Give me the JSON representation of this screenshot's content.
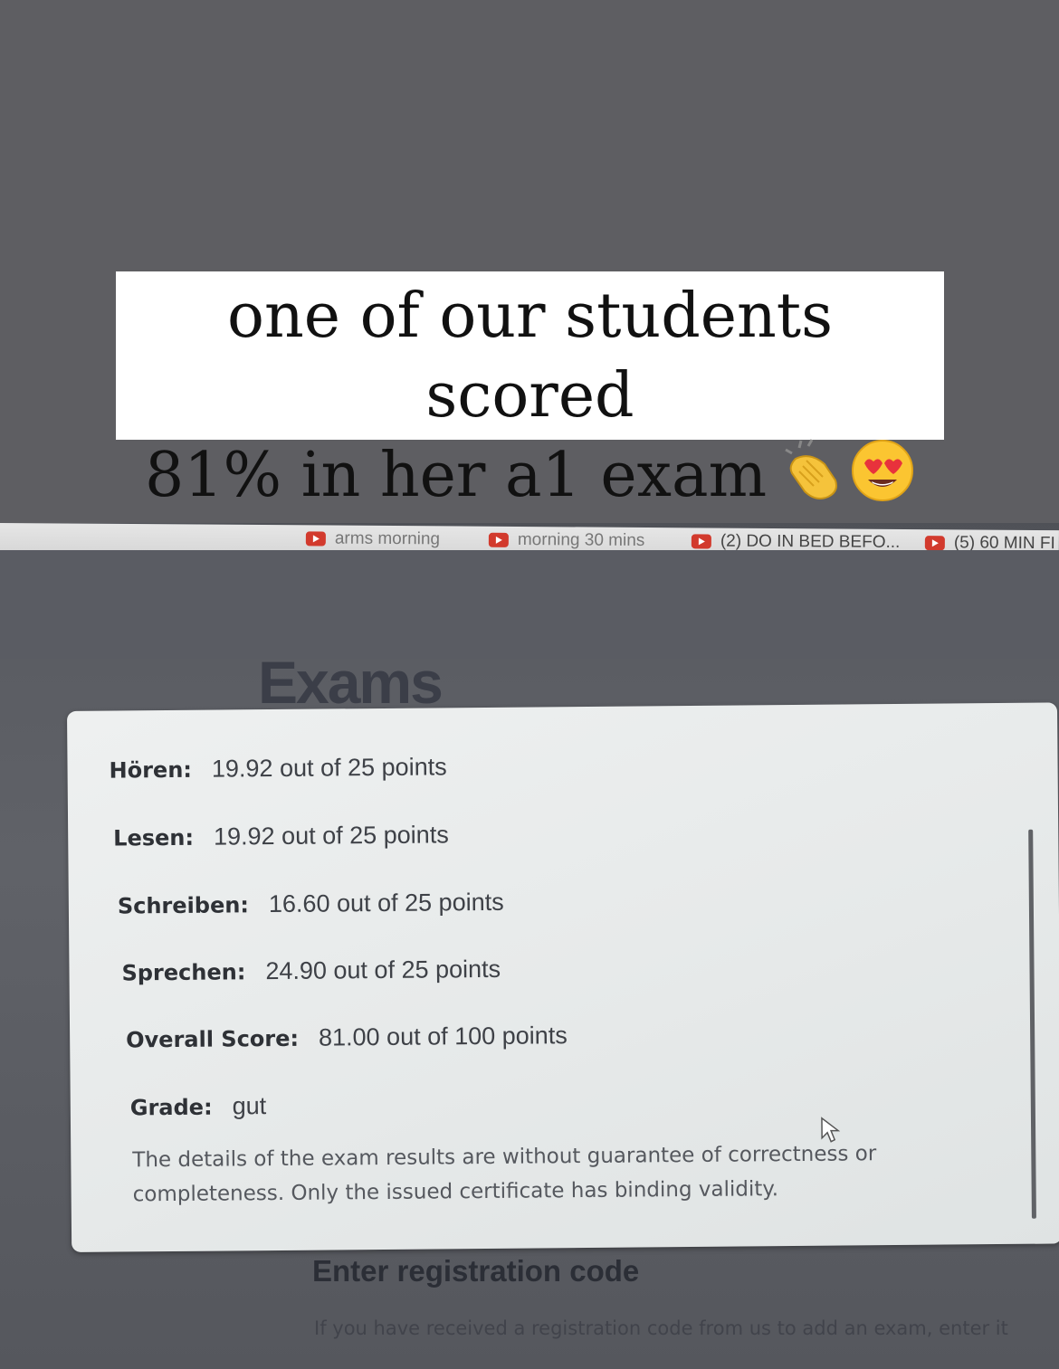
{
  "story": {
    "caption_line1": "one of our students scored",
    "caption_line2": "81% in her a1 exam",
    "emojis": [
      "clapping-hands-icon",
      "heart-eyes-face-icon"
    ]
  },
  "browser": {
    "bookmarks": [
      {
        "label": "arms morning",
        "icon": "youtube-icon"
      },
      {
        "label": "morning 30 mins",
        "icon": "youtube-icon"
      },
      {
        "label": "(2) DO IN BED BEFO...",
        "icon": "youtube-icon"
      },
      {
        "label": "(5) 60 MIN FI",
        "icon": "youtube-icon"
      }
    ]
  },
  "page": {
    "title": "Exams",
    "results": [
      {
        "label": "Hören:",
        "value": "19.92 out of 25 points"
      },
      {
        "label": "Lesen:",
        "value": "19.92 out of 25 points"
      },
      {
        "label": "Schreiben:",
        "value": "16.60 out of 25 points"
      },
      {
        "label": "Sprechen:",
        "value": "24.90 out of 25 points"
      },
      {
        "label": "Overall Score:",
        "value": "81.00 out of 100 points"
      },
      {
        "label": "Grade:",
        "value": "gut"
      }
    ],
    "disclaimer": "The details of the exam results are without guarantee of correctness or completeness. Only the issued certificate has binding validity.",
    "registration": {
      "title": "Enter registration code",
      "description": "If you have received a registration code from us to add an exam, enter it"
    }
  },
  "colors": {
    "youtube_red": "#d23a2d",
    "story_background": "#5e5e62"
  }
}
